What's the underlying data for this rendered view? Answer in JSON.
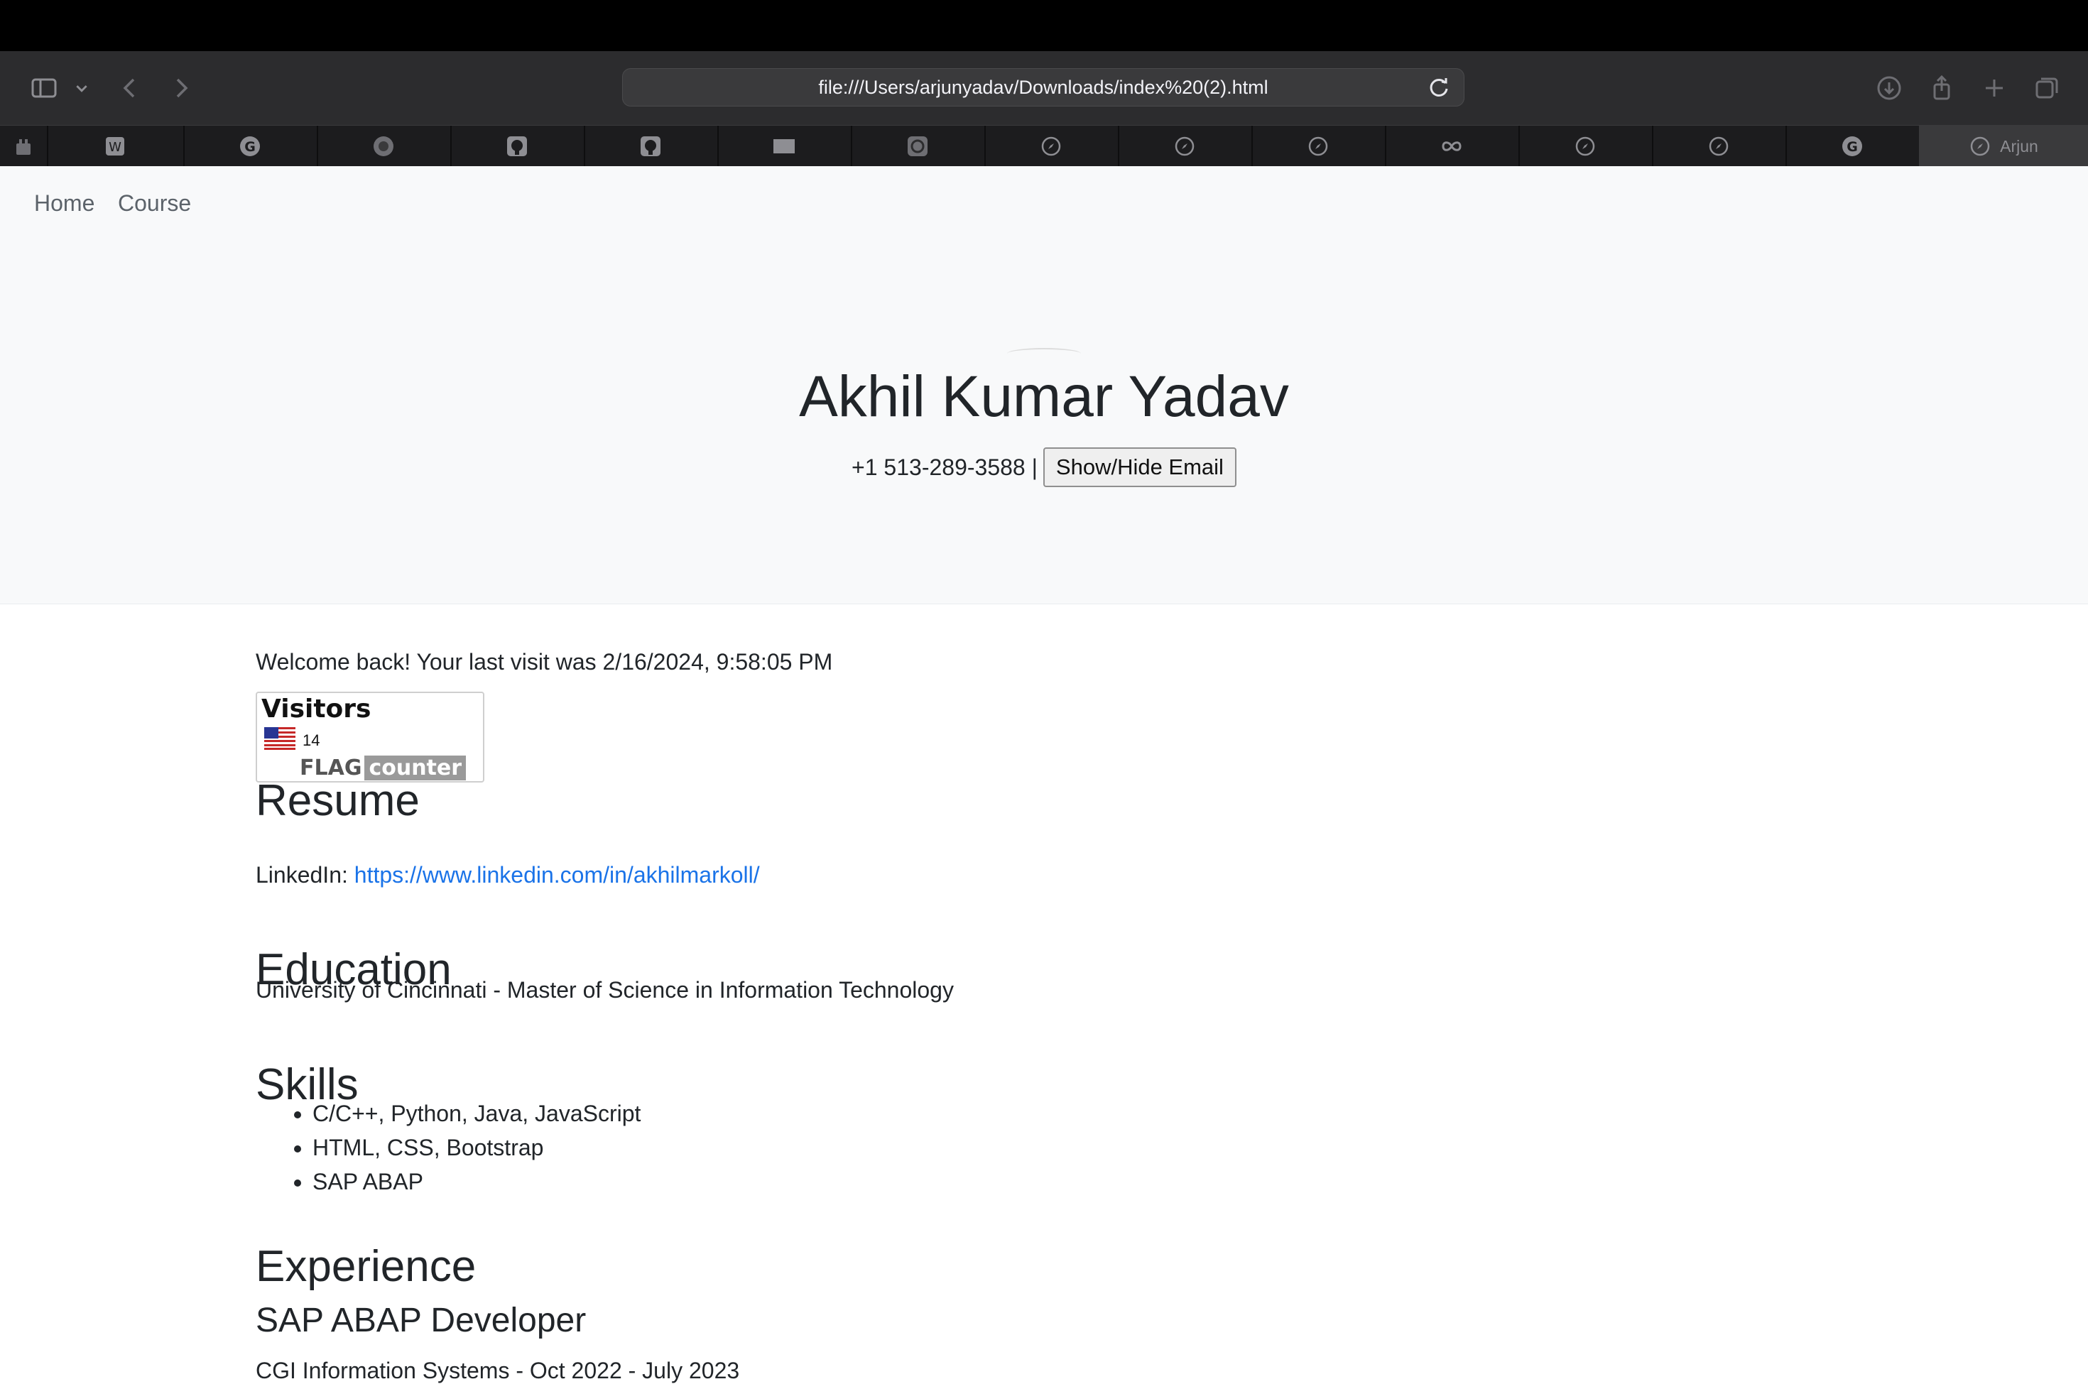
{
  "browser": {
    "url": "file:///Users/arjunyadav/Downloads/index%20(2).html",
    "active_tab_label": "Arjun",
    "tabs": [
      {
        "icon": "extension-icon"
      },
      {
        "icon": "site-favicon-icon"
      },
      {
        "icon": "google-icon"
      },
      {
        "icon": "site-favicon-icon"
      },
      {
        "icon": "github-icon"
      },
      {
        "icon": "github-icon"
      },
      {
        "icon": "rectangle-favicon-icon"
      },
      {
        "icon": "openai-icon"
      },
      {
        "icon": "compass-icon"
      },
      {
        "icon": "compass-icon"
      },
      {
        "icon": "compass-icon"
      },
      {
        "icon": "infinity-icon"
      },
      {
        "icon": "compass-icon"
      },
      {
        "icon": "compass-icon"
      },
      {
        "icon": "google-icon"
      }
    ]
  },
  "nav": {
    "home": "Home",
    "course": "Course"
  },
  "hero": {
    "name": "Akhil Kumar Yadav",
    "phone": "+1 513-289-3588 |",
    "email_button": "Show/Hide Email"
  },
  "welcome": "Welcome back! Your last visit was 2/16/2024, 9:58:05 PM",
  "flag_counter": {
    "title": "Visitors",
    "count": "14",
    "brand_flag": "FLAG",
    "brand_counter": "counter"
  },
  "resume": {
    "heading": "Resume",
    "linkedin_label": "LinkedIn:",
    "linkedin_url": "https://www.linkedin.com/in/akhilmarkoll/"
  },
  "education": {
    "heading": "Education",
    "text": "University of Cincinnati - Master of Science in Information Technology"
  },
  "skills": {
    "heading": "Skills",
    "items": [
      "C/C++, Python, Java, JavaScript",
      "HTML, CSS, Bootstrap",
      "SAP ABAP"
    ]
  },
  "experience": {
    "heading": "Experience",
    "job_title": "SAP ABAP Developer",
    "job_detail": "CGI Information Systems - Oct 2022 - July 2023"
  },
  "colors": {
    "link": "#1a73e8",
    "hero_bg": "#f8f9fa",
    "toolbar_bg": "#2c2c2e"
  }
}
